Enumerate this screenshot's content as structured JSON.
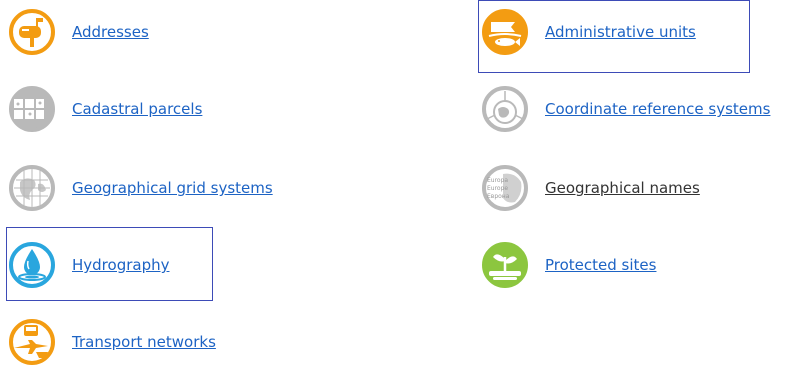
{
  "themes": {
    "addresses": {
      "label": "Addresses",
      "icon": "mailbox-icon",
      "color": "#f39c12"
    },
    "administrative_units": {
      "label": "Administrative units",
      "icon": "flag-fish-icon",
      "color": "#f39c12"
    },
    "cadastral_parcels": {
      "label": "Cadastral parcels",
      "icon": "parcels-icon",
      "color": "#b9b9b9"
    },
    "coordinate_reference_systems": {
      "label": "Coordinate reference systems",
      "icon": "axes-globe-icon",
      "color": "#b9b9b9"
    },
    "geographical_grid_systems": {
      "label": "Geographical grid systems",
      "icon": "grid-globe-icon",
      "color": "#b9b9b9"
    },
    "geographical_names": {
      "label": "Geographical names",
      "icon": "europe-names-icon",
      "color": "#b9b9b9",
      "names": [
        "Europa",
        "Europe",
        "Еврона"
      ]
    },
    "hydrography": {
      "label": "Hydrography",
      "icon": "water-drop-icon",
      "color": "#29a6de"
    },
    "protected_sites": {
      "label": "Protected sites",
      "icon": "plant-icon",
      "color": "#8cc63f"
    },
    "transport_networks": {
      "label": "Transport networks",
      "icon": "transport-icon",
      "color": "#f39c12"
    }
  },
  "selection_color": "#3d4bb7"
}
